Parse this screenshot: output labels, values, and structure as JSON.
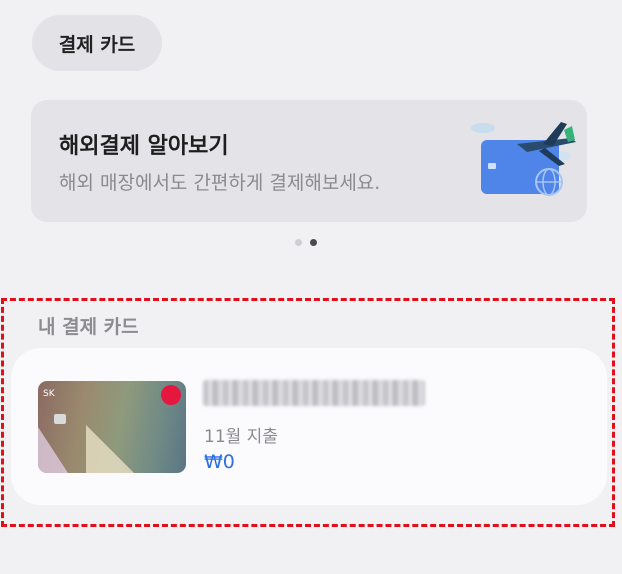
{
  "header": {
    "chip_label": "결제 카드"
  },
  "banner": {
    "title": "해외결제 알아보기",
    "subtitle": "해외 매장에서도 간편하게 결제해보세요."
  },
  "pager": {
    "count": 2,
    "active_index": 1
  },
  "my_cards": {
    "section_title": "내 결제 카드",
    "cards": [
      {
        "spend_label": "11월 지출",
        "amount": "₩0"
      }
    ]
  },
  "colors": {
    "amount": "#2f6fe3",
    "highlight": "#e0101a",
    "background": "#f1f1f3"
  }
}
